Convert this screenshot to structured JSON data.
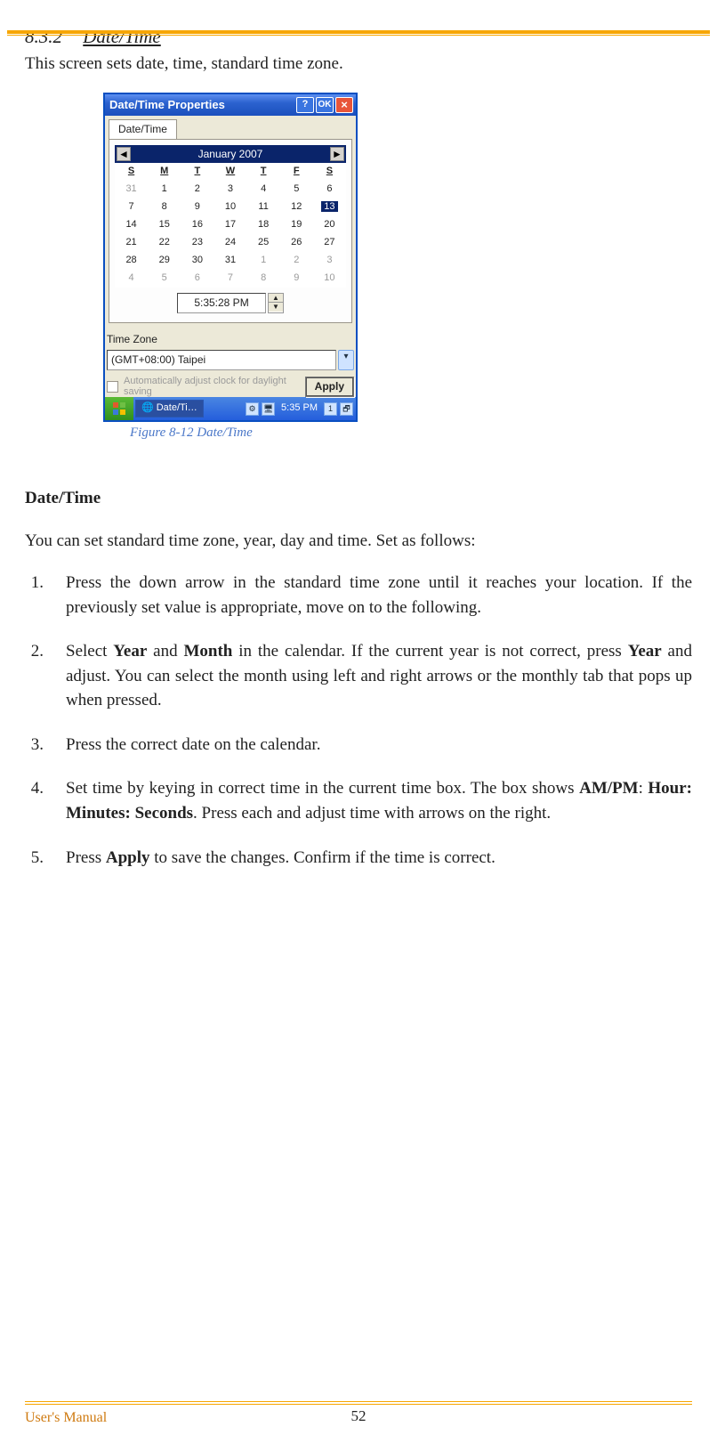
{
  "page": {
    "section_number": "8.3.2",
    "section_title": "Date/Time",
    "intro": "This screen sets date, time, standard time zone.",
    "figure_caption": "Figure 8-12 Date/Time",
    "heading": "Date/Time",
    "lead": "You can set standard time zone, year, day and time. Set as follows:",
    "footer_left": "User's Manual",
    "page_number": "52"
  },
  "steps": {
    "s1": "Press the down arrow in the standard time zone until it reaches your location. If the previously set value is appropriate, move on to the following.",
    "s2a": "Select ",
    "s2b": "Year",
    "s2c": " and ",
    "s2d": "Month",
    "s2e": " in the calendar. If the current year is not correct, press ",
    "s2f": "Year",
    "s2g": " and adjust. You can select the month using left and right arrows or the monthly tab that pops up when pressed.",
    "s3": "Press the correct date on the calendar.",
    "s4a": "Set time by keying in correct time in the current time box. The box shows ",
    "s4b": "AM/PM",
    "s4c": ": ",
    "s4d": "Hour: Minutes: Seconds",
    "s4e": ". Press each and adjust time with arrows on the right.",
    "s5a": "Press ",
    "s5b": "Apply",
    "s5c": " to save the changes. Confirm if the time is correct."
  },
  "dialog": {
    "title": "Date/Time Properties",
    "help_btn": "?",
    "ok_btn": "OK",
    "close_btn": "×",
    "tab_label": "Date/Time",
    "month_label": "January 2007",
    "prev_arrow": "◄",
    "next_arrow": "►",
    "dow": {
      "s1": "S",
      "m": "M",
      "t1": "T",
      "w": "W",
      "t2": "T",
      "f": "F",
      "s2": "S"
    },
    "time_value": "5:35:28 PM",
    "spin_up": "▲",
    "spin_down": "▼",
    "tz_label": "Time Zone",
    "tz_value": "(GMT+08:00) Taipei",
    "tz_drop": "▾",
    "dst_label": "Automatically adjust clock for daylight saving",
    "apply_label": "Apply"
  },
  "calendar": {
    "r1": {
      "c1": "31",
      "c2": "1",
      "c3": "2",
      "c4": "3",
      "c5": "4",
      "c6": "5",
      "c7": "6"
    },
    "r2": {
      "c1": "7",
      "c2": "8",
      "c3": "9",
      "c4": "10",
      "c5": "11",
      "c6": "12",
      "c7": "13"
    },
    "r3": {
      "c1": "14",
      "c2": "15",
      "c3": "16",
      "c4": "17",
      "c5": "18",
      "c6": "19",
      "c7": "20"
    },
    "r4": {
      "c1": "21",
      "c2": "22",
      "c3": "23",
      "c4": "24",
      "c5": "25",
      "c6": "26",
      "c7": "27"
    },
    "r5": {
      "c1": "28",
      "c2": "29",
      "c3": "30",
      "c4": "31",
      "c5": "1",
      "c6": "2",
      "c7": "3"
    },
    "r6": {
      "c1": "4",
      "c2": "5",
      "c3": "6",
      "c4": "7",
      "c5": "8",
      "c6": "9",
      "c7": "10"
    }
  },
  "taskbar": {
    "app_label": "Date/Ti…",
    "clock": "5:35 PM",
    "badge": "1"
  }
}
